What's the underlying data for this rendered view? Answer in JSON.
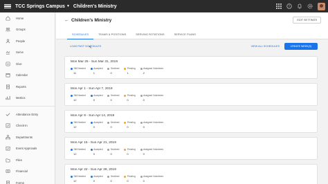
{
  "topbar": {
    "campus": "TCC Springs Campus",
    "ministry": "Children's Ministry",
    "icons": [
      "grid-icon",
      "help-icon",
      "bell-icon",
      "settings-icon"
    ]
  },
  "sidebar": {
    "items": [
      {
        "label": "Home",
        "icon": "home-icon"
      },
      {
        "label": "Groups",
        "icon": "groups-icon"
      },
      {
        "label": "People",
        "icon": "people-icon"
      },
      {
        "label": "Serve",
        "icon": "serve-icon"
      },
      {
        "label": "Give",
        "icon": "give-icon"
      },
      {
        "label": "Calendar",
        "icon": "calendar-icon"
      },
      {
        "label": "Reports",
        "icon": "reports-icon"
      },
      {
        "label": "Metrics",
        "icon": "metrics-icon"
      }
    ],
    "items2": [
      {
        "label": "Attendance Entry",
        "icon": "attendance-icon"
      },
      {
        "label": "Check-In",
        "icon": "checkin-icon"
      },
      {
        "label": "Departments",
        "icon": "departments-icon"
      },
      {
        "label": "Event Approvals",
        "icon": "approvals-icon"
      },
      {
        "label": "Files",
        "icon": "files-icon"
      },
      {
        "label": "Financial",
        "icon": "financial-icon"
      },
      {
        "label": "Forms",
        "icon": "forms-icon"
      }
    ]
  },
  "header": {
    "back": "←",
    "title": "Children's Ministry",
    "edit_settings": "EDIT SETTINGS",
    "tabs": [
      "SCHEDULES",
      "TEAMS & POSITIONS",
      "SERVING ROTATIONS",
      "SERVICE PLANS"
    ]
  },
  "actions": {
    "load_past": "LOAD PAST SCHEDULES",
    "view_all": "VIEW ALL SCHEDULES",
    "create_weeks": "CREATE WEEK(S)"
  },
  "stat_labels": [
    "Still Needed",
    "Accepted",
    "Declined",
    "Pending",
    "Assigned Volunteers"
  ],
  "colors": {
    "still_needed": "#1a73e8",
    "accepted": "#1a73e8",
    "declined": "#9e9e9e",
    "pending": "#f5a623",
    "assigned": "#9e9e9e",
    "accent": "#1a73e8"
  },
  "weeks": [
    {
      "title": "Mon Mar 25 - Sun Mar 31, 2019",
      "values": [
        "11",
        "1",
        "0",
        "1",
        "2"
      ]
    },
    {
      "title": "Mon Apr 1 - Sun Apr 7, 2019",
      "values": [
        "12",
        "0",
        "0",
        "0",
        "0"
      ]
    },
    {
      "title": "Mon Apr 8 - Sun Apr 14, 2019",
      "values": [
        "12",
        "0",
        "0",
        "0",
        "0"
      ]
    },
    {
      "title": "Mon Apr 15 - Sun Apr 21, 2019",
      "values": [
        "12",
        "0",
        "0",
        "0",
        "0"
      ]
    },
    {
      "title": "Mon Apr 22 - Sun Apr 28, 2019",
      "values": [
        "12",
        "0",
        "0",
        "0",
        "0"
      ]
    }
  ]
}
